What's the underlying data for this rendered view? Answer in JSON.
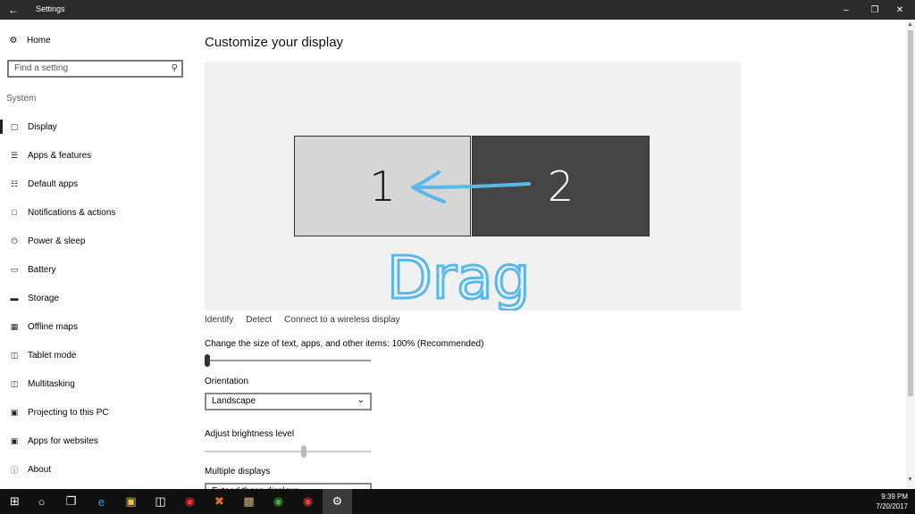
{
  "titlebar": {
    "title": "Settings"
  },
  "sidebar": {
    "home_label": "Home",
    "search_placeholder": "Find a setting",
    "section_label": "System",
    "items": [
      {
        "label": "Display",
        "icon": "monitor-icon"
      },
      {
        "label": "Apps & features",
        "icon": "list-icon"
      },
      {
        "label": "Default apps",
        "icon": "default-apps-icon"
      },
      {
        "label": "Notifications & actions",
        "icon": "message-icon"
      },
      {
        "label": "Power & sleep",
        "icon": "power-icon"
      },
      {
        "label": "Battery",
        "icon": "battery-icon"
      },
      {
        "label": "Storage",
        "icon": "storage-icon"
      },
      {
        "label": "Offline maps",
        "icon": "map-icon"
      },
      {
        "label": "Tablet mode",
        "icon": "tablet-icon"
      },
      {
        "label": "Multitasking",
        "icon": "multitasking-icon"
      },
      {
        "label": "Projecting to this PC",
        "icon": "projecting-icon"
      },
      {
        "label": "Apps for websites",
        "icon": "websites-icon"
      },
      {
        "label": "About",
        "icon": "info-icon"
      }
    ]
  },
  "main": {
    "title": "Customize your display",
    "monitor_1": "1",
    "monitor_2": "2",
    "annotation": "Drag",
    "links": {
      "identify": "Identify",
      "detect": "Detect",
      "wireless": "Connect to a wireless display"
    },
    "scale_label": "Change the size of text, apps, and other items: 100% (Recommended)",
    "scale_value": 0,
    "orientation_label": "Orientation",
    "orientation_value": "Landscape",
    "brightness_label": "Adjust brightness level",
    "brightness_value": 60,
    "multiple_label": "Multiple displays",
    "multiple_value": "Extend these displays"
  },
  "taskbar": {
    "time": "9:39 PM",
    "date": "7/20/2017"
  },
  "colors": {
    "annotation": "#5ab8e8",
    "monitor_1": "#d6d6d6",
    "monitor_2": "#454545"
  }
}
